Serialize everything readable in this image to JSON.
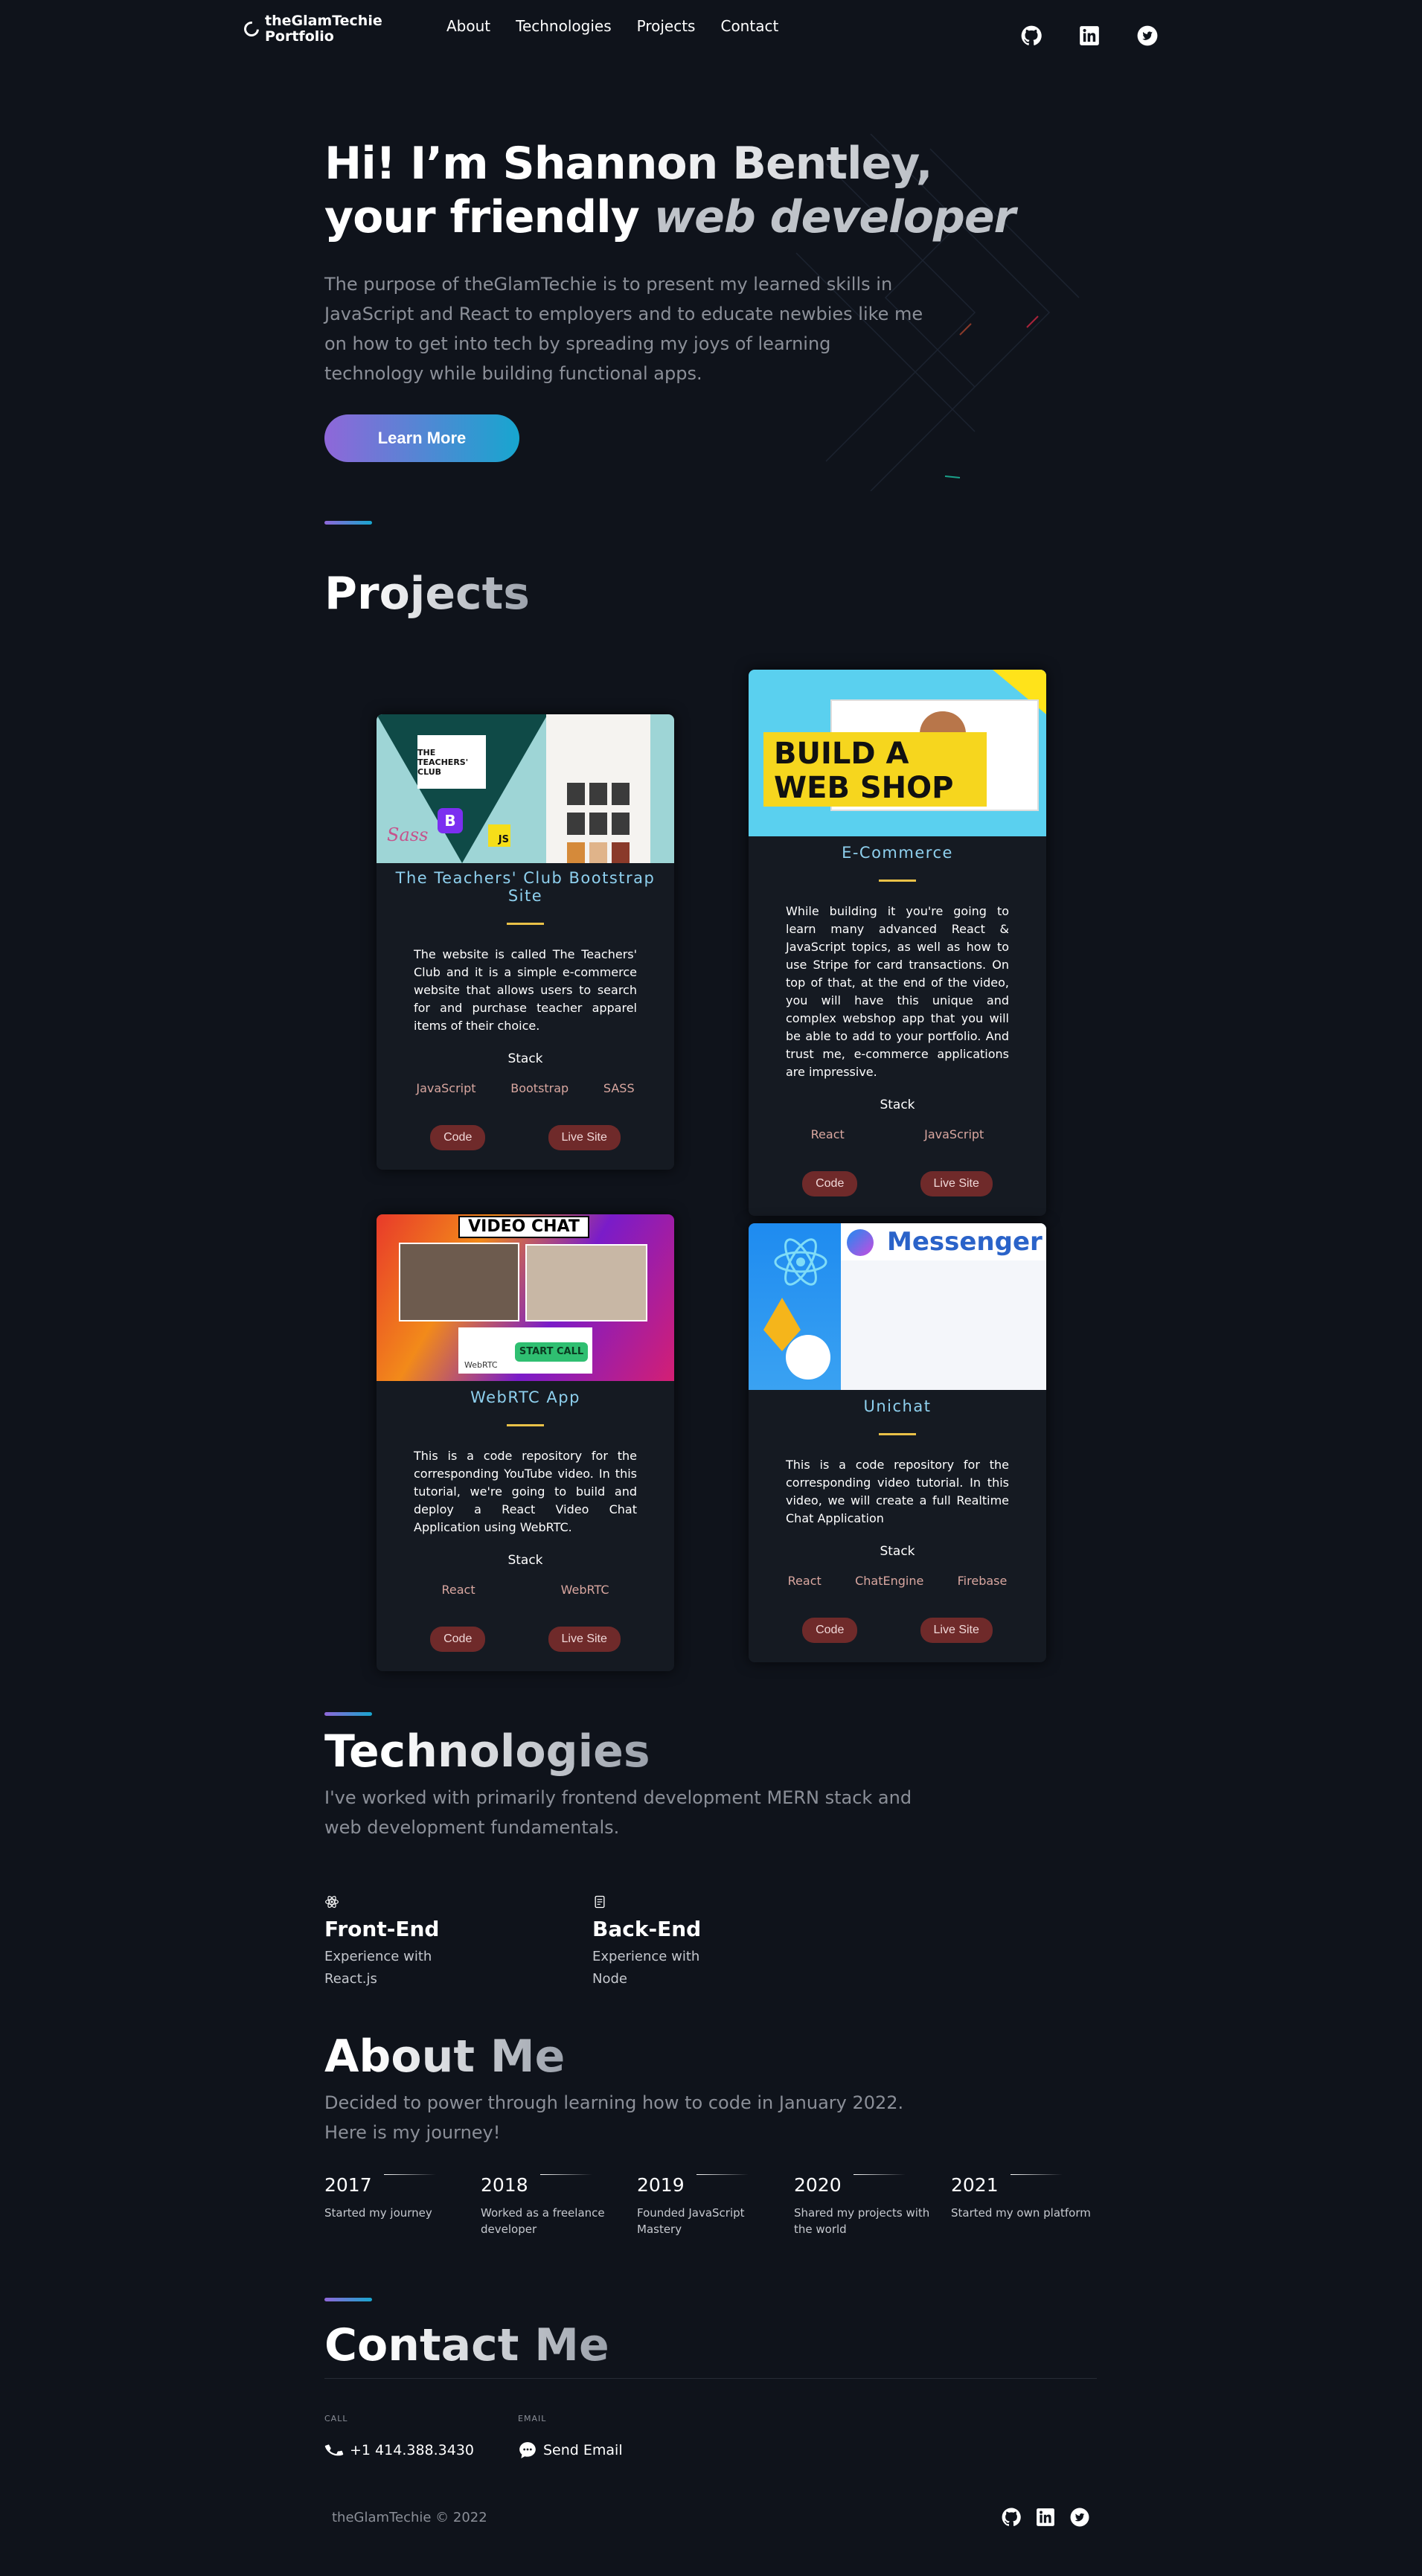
{
  "nav": {
    "logo_line1": "theGlamTechie",
    "logo_line2": "Portfolio",
    "links": [
      "About",
      "Technologies",
      "Projects",
      "Contact"
    ],
    "social_icons": [
      "github-icon",
      "linkedin-icon",
      "twitter-icon"
    ]
  },
  "hero": {
    "title_line1": "Hi! I’m Shannon Bentley,",
    "title_line2_plain": "your friendly ",
    "title_line2_italic": "web developer",
    "description": "The purpose of theGlamTechie is to present my learned skills in JavaScript and React to employers and to educate newbies like me on how to get into tech by spreading my joys of learning technology while building functional apps.",
    "button": "Learn More"
  },
  "projects": {
    "title": "Projects",
    "stack_label": "Stack",
    "code_label": "Code",
    "live_label": "Live Site",
    "items": [
      {
        "title": "The Teachers' Club Bootstrap Site",
        "description": "The website is called The Teachers' Club and it is a simple e-commerce website that allows users to search for and purchase teacher apparel items of their choice.",
        "stack": [
          "JavaScript",
          "Bootstrap",
          "SASS"
        ],
        "image_logo_text": "THE TEACHERS' CLUB",
        "image_badges": [
          "B",
          "JS",
          "Sass"
        ]
      },
      {
        "title": "E-Commerce",
        "description": "While building it you're going to learn many advanced React & JavaScript topics, as well as how to use Stripe for card transactions. On top of that, at the end of the video, you will have this unique and complex webshop app that you will be able to add to your portfolio. And trust me, e-commerce applications are impressive.",
        "stack": [
          "React",
          "JavaScript"
        ],
        "image_text_line1": "BUILD A",
        "image_text_line2": "WEB SHOP"
      },
      {
        "title": "WebRTC App",
        "description": "This is a code repository for the corresponding YouTube video. In this tutorial, we're going to build and deploy a React Video Chat Application using WebRTC.",
        "stack": [
          "React",
          "WebRTC"
        ],
        "image_header": "VIDEO CHAT",
        "image_button": "START CALL",
        "image_label": "WebRTC"
      },
      {
        "title": "Unichat",
        "description": "This is a code repository for the corresponding video tutorial. In this video, we will create a full Realtime Chat Application",
        "stack": [
          "React",
          "ChatEngine",
          "Firebase"
        ],
        "image_header": "Messenger"
      }
    ]
  },
  "technologies": {
    "title": "Technologies",
    "description": "I've worked with primarily frontend development MERN stack and web development fundamentals.",
    "items": [
      {
        "name": "Front-End",
        "line1": "Experience with",
        "line2": "React.js",
        "icon": "react-icon"
      },
      {
        "name": "Back-End",
        "line1": "Experience with",
        "line2": "Node",
        "icon": "server-icon"
      }
    ]
  },
  "about": {
    "title": "About Me",
    "description_line1": "Decided to power through learning how to code in January 2022.",
    "description_line2": "Here is my journey!",
    "timeline": [
      {
        "year": "2017",
        "text": "Started my journey"
      },
      {
        "year": "2018",
        "text": "Worked as a freelance developer"
      },
      {
        "year": "2019",
        "text": "Founded JavaScript Mastery"
      },
      {
        "year": "2020",
        "text": "Shared my projects with the world"
      },
      {
        "year": "2021",
        "text": "Started my own platform"
      }
    ]
  },
  "contact": {
    "title": "Contact Me",
    "call_label": "CALL",
    "phone": "+1 414.388.3430",
    "email_label": "EMAIL",
    "email_text": "Send Email"
  },
  "footer": {
    "copyright": "theGlamTechie © 2022"
  },
  "colors": {
    "background": "#0f131b",
    "accent_gradient_start": "#8f67d9",
    "accent_gradient_end": "#17a6cf",
    "card_title": "#8ed0ee",
    "card_separator": "#e9c148",
    "card_button": "#6f2a2a",
    "stack_text": "#d9a7a0"
  }
}
